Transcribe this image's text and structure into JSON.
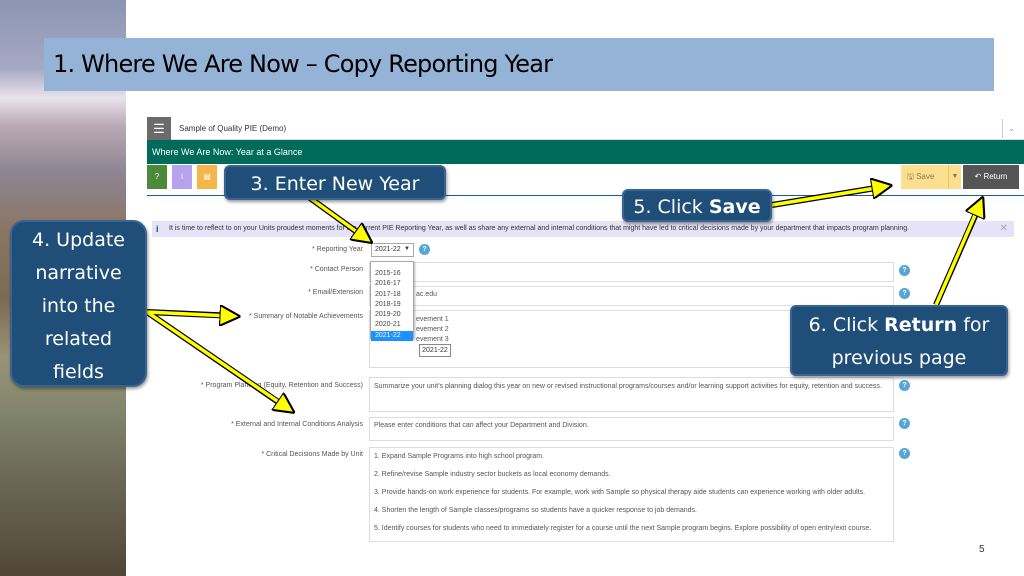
{
  "slide": {
    "title": "1. Where We Are Now – Copy Reporting Year",
    "page_number": "5"
  },
  "app": {
    "name": "Sample of Quality PIE (Demo)",
    "page_header": "Where We Are Now: Year at a Glance",
    "toolbar": {
      "help_label": "?",
      "info_label": "i",
      "save_label": "Save",
      "return_label": "Return"
    },
    "info_message": "It is time to reflect to on your Units proudest moments for the current PIE Reporting Year, as well as share any external and internal conditions that might have led to critical decisions made by your department that impacts program planning.",
    "form": {
      "reporting_year": {
        "label": "Reporting Year",
        "value": "2021-22"
      },
      "year_options": [
        "2015-16",
        "2016-17",
        "2017-18",
        "2018-19",
        "2019-20",
        "2020-21",
        "2021-22"
      ],
      "selected_option": "2021-22",
      "contact_person": {
        "label": "Contact Person",
        "value": ""
      },
      "email": {
        "label": "Email/Extension",
        "value": "ac.edu"
      },
      "summary": {
        "label": "Summary of Notable Achievements",
        "lines": [
          "evement 1",
          "evement 2",
          "evement 3"
        ],
        "year_chip": "2021-22"
      },
      "program_planning": {
        "label": "Program Planning (Equity, Retention and Success)",
        "value": "Summarize your unit's planning dialog this year on new or revised instructional programs/courses and/or learning support activities for equity, retention and success."
      },
      "conditions": {
        "label": "External and Internal Conditions Analysis",
        "value": "Please enter conditions that can affect your Department and Division."
      },
      "decisions": {
        "label": "Critical Decisions Made by Unit",
        "items": [
          "1. Expand Sample Programs into high school program.",
          "2. Refine/revise Sample industry sector buckets as local economy demands.",
          "3. Provide hands-on work experience for students.  For example, work with Sample so physical therapy aide students can experience working with older adults.",
          "4. Shorten the length of Sample classes/programs so students have a quicker response to job demands.",
          "5. Identify courses for students who need to immediately register for a course until the next Sample program begins. Explore possibility of open entry/exit course."
        ]
      }
    }
  },
  "callouts": {
    "step3": "3. Enter New Year",
    "step4": [
      "4. Update",
      "narrative",
      "into the",
      "related",
      "fields"
    ],
    "step5_prefix": "5. Click ",
    "step5_bold": "Save",
    "step6_prefix": "6. Click ",
    "step6_bold": "Return",
    "step6_suffix": " for",
    "step6_line2": "previous page"
  },
  "colors": {
    "title_bar": "#95b3d7",
    "app_header": "#006b5a",
    "callout": "#1f4e79",
    "arrow": "#ffff00"
  }
}
